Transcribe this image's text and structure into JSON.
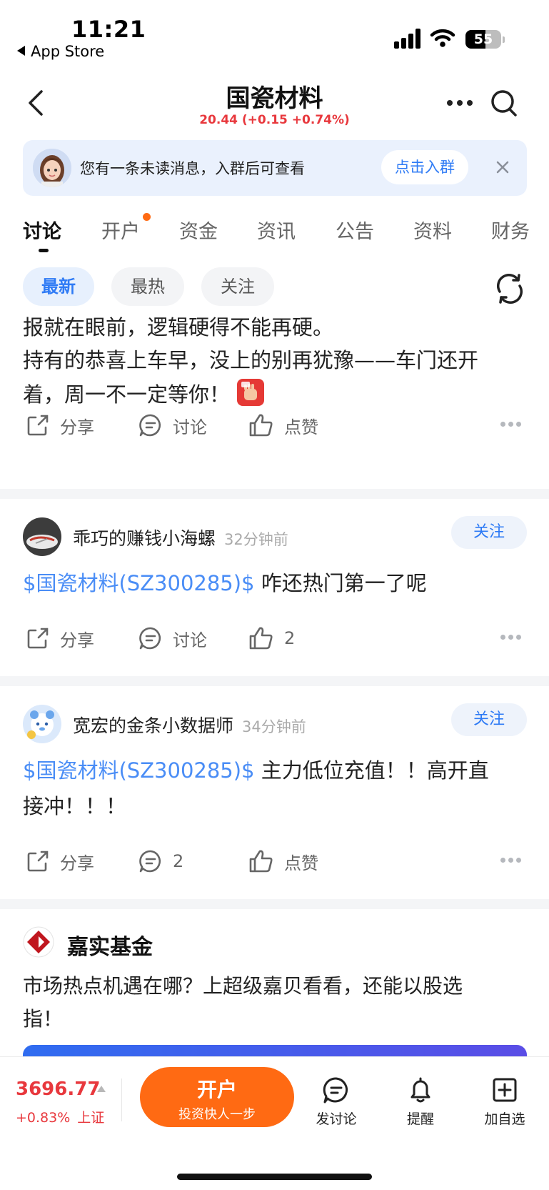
{
  "status_bar": {
    "time": "11:21",
    "back_app": "App Store",
    "battery": "55"
  },
  "nav": {
    "title": "国瓷材料",
    "quote": "20.44 (+0.15 +0.74%)",
    "quote_color": "#e8383d"
  },
  "notice": {
    "text": "您有一条未读消息，入群后可查看",
    "button": "点击入群"
  },
  "tabs": [
    {
      "label": "讨论",
      "active": true
    },
    {
      "label": "开户",
      "has_dot": true
    },
    {
      "label": "资金"
    },
    {
      "label": "资讯"
    },
    {
      "label": "公告"
    },
    {
      "label": "资料"
    },
    {
      "label": "财务"
    }
  ],
  "filters": {
    "items": [
      "最新",
      "最热",
      "关注"
    ],
    "selected": "最新"
  },
  "posts": [
    {
      "text_lines": [
        "报就在眼前，逻辑硬得不能再硬。",
        "持有的恭喜上车早，没上的别再犹豫——车门还开",
        "着，周一不一定等你！"
      ],
      "emoji": "抱拳",
      "actions": {
        "share": "分享",
        "comment": "讨论",
        "like": "点赞"
      }
    },
    {
      "user": "乖巧的赚钱小海螺",
      "time": "32分钟前",
      "follow": "关注",
      "stock_tag": "$国瓷材料(SZ300285)$",
      "text": " 咋还热门第一了呢",
      "actions": {
        "share": "分享",
        "comment": "讨论",
        "like": "2"
      }
    },
    {
      "user": "宽宏的金条小数据师",
      "time": "34分钟前",
      "follow": "关注",
      "stock_tag": "$国瓷材料(SZ300285)$",
      "text": " 主力低位充值！！高开直",
      "text_line2": "接冲！！！",
      "actions": {
        "share": "分享",
        "comment": "2",
        "like": "点赞"
      }
    }
  ],
  "ad": {
    "name": "嘉实基金",
    "line1": "市场热点机遇在哪？上超级嘉贝看看，还能以股选",
    "line2": "指！"
  },
  "bottom": {
    "index_value": "3696.77",
    "index_change": "+0.83%",
    "index_name": "上证",
    "open_main": "开户",
    "open_sub": "投资快人一步",
    "post_label": "发讨论",
    "remind_label": "提醒",
    "watch_label": "加自选",
    "accent": "#ff6a13"
  }
}
